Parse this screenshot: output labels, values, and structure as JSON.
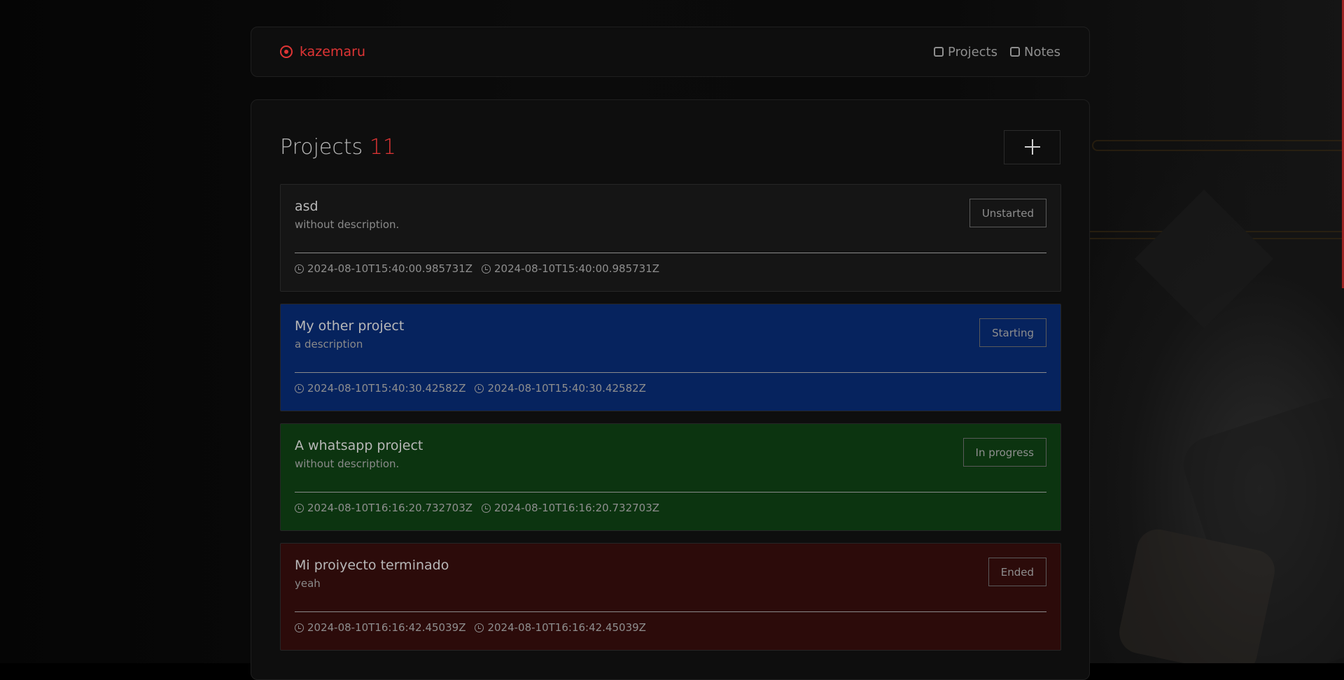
{
  "colors": {
    "accent": "#e03535",
    "card_default": "#151515",
    "card_starting": "#06235e",
    "card_in_progress": "#0c3410",
    "card_ended": "#2c0b0a"
  },
  "nav": {
    "brand": "kazemaru",
    "links": [
      {
        "label": "Projects",
        "icon": "box-icon"
      },
      {
        "label": "Notes",
        "icon": "note-icon"
      }
    ]
  },
  "header": {
    "title": "Projects",
    "count": "11",
    "add_icon": "plus-icon"
  },
  "projects": [
    {
      "name": "asd",
      "description": "without description.",
      "status": "Unstarted",
      "created": "2024-08-10T15:40:00.985731Z",
      "updated": "2024-08-10T15:40:00.985731Z",
      "color": "#151515"
    },
    {
      "name": "My other project",
      "description": "a description",
      "status": "Starting",
      "created": "2024-08-10T15:40:30.42582Z",
      "updated": "2024-08-10T15:40:30.42582Z",
      "color": "#06235e"
    },
    {
      "name": "A whatsapp project",
      "description": "without description.",
      "status": "In progress",
      "created": "2024-08-10T16:16:20.732703Z",
      "updated": "2024-08-10T16:16:20.732703Z",
      "color": "#0c3410"
    },
    {
      "name": "Mi proiyecto terminado",
      "description": "yeah",
      "status": "Ended",
      "created": "2024-08-10T16:16:42.45039Z",
      "updated": "2024-08-10T16:16:42.45039Z",
      "color": "#2c0b0a"
    }
  ]
}
